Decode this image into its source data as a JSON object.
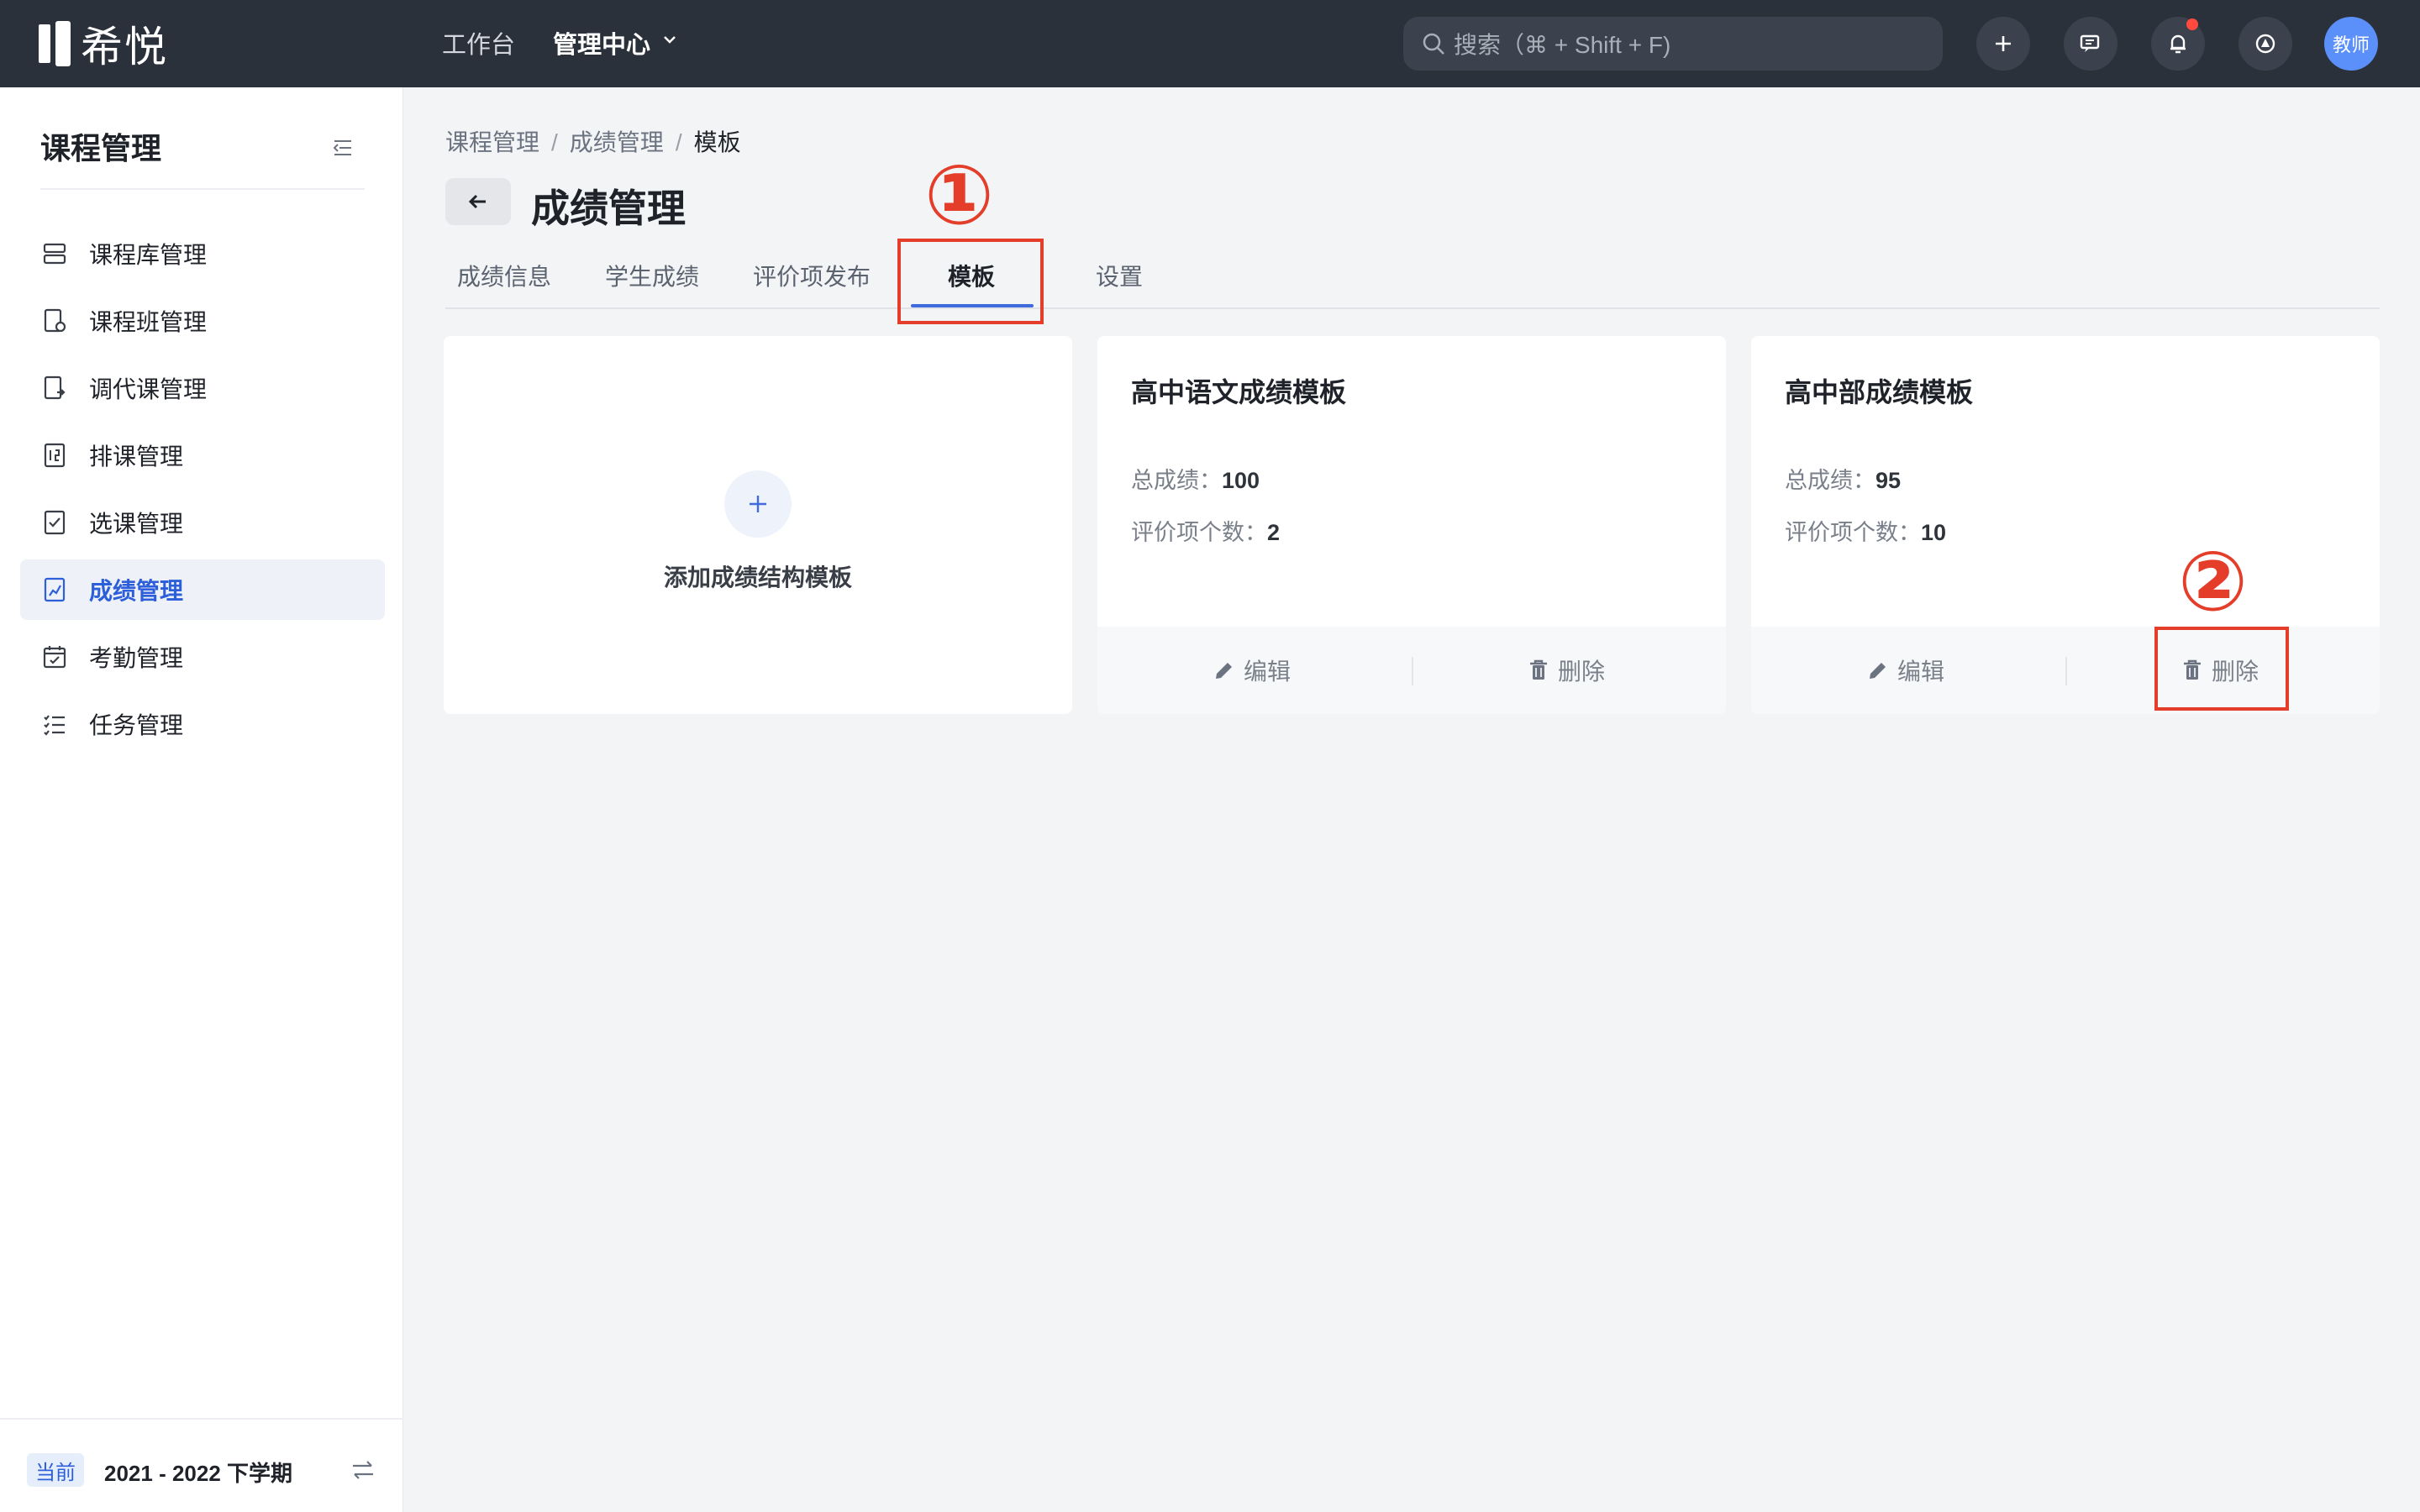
{
  "topbar": {
    "logo_text": "希悦",
    "nav": [
      {
        "label": "工作台"
      },
      {
        "label": "管理中心"
      }
    ],
    "search_placeholder": "搜索（⌘ + Shift + F)",
    "avatar_label": "教师",
    "notification_dot_color": "#ff4a3d"
  },
  "sidebar": {
    "title": "课程管理",
    "items": [
      {
        "label": "课程库管理",
        "icon": "course-library-icon"
      },
      {
        "label": "课程班管理",
        "icon": "class-icon"
      },
      {
        "label": "调代课管理",
        "icon": "substitute-icon"
      },
      {
        "label": "排课管理",
        "icon": "schedule-icon"
      },
      {
        "label": "选课管理",
        "icon": "checkbox-icon"
      },
      {
        "label": "成绩管理",
        "icon": "grade-icon",
        "active": true
      },
      {
        "label": "考勤管理",
        "icon": "calendar-icon"
      },
      {
        "label": "任务管理",
        "icon": "task-list-icon"
      }
    ],
    "footer": {
      "tag": "当前",
      "term": "2021 - 2022 下学期"
    }
  },
  "breadcrumb": [
    "课程管理",
    "成绩管理",
    "模板"
  ],
  "page_title": "成绩管理",
  "tabs": [
    {
      "label": "成绩信息"
    },
    {
      "label": "学生成绩"
    },
    {
      "label": "评价项发布"
    },
    {
      "label": "模板",
      "active": true
    },
    {
      "label": "设置"
    }
  ],
  "add_card": {
    "label": "添加成绩结构模板"
  },
  "templates": [
    {
      "title": "高中语文成绩模板",
      "total_label": "总成绩：",
      "total_value": "100",
      "items_label": "评价项个数：",
      "items_value": "2",
      "edit_label": "编辑",
      "delete_label": "删除"
    },
    {
      "title": "高中部成绩模板",
      "total_label": "总成绩：",
      "total_value": "95",
      "items_label": "评价项个数：",
      "items_value": "10",
      "edit_label": "编辑",
      "delete_label": "删除"
    }
  ],
  "annotations": {
    "one": "①",
    "two": "②",
    "color": "#e43d2a"
  },
  "colors": {
    "accent": "#2c5fd9",
    "topbar": "#2b313b"
  }
}
